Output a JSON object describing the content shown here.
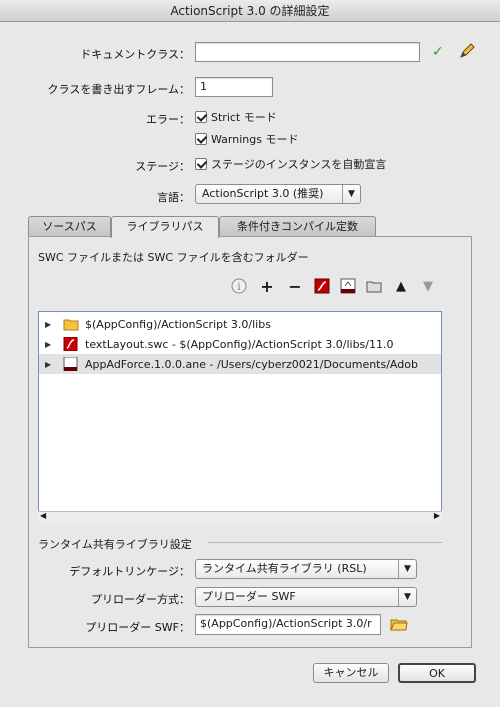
{
  "window": {
    "title": "ActionScript 3.0 の詳細設定"
  },
  "document_class": {
    "label": "ドキュメントクラス：",
    "value": ""
  },
  "export_frame": {
    "label": "クラスを書き出すフレーム：",
    "value": "1"
  },
  "errors": {
    "label": "エラー：",
    "strict_label": "Strict モード",
    "warnings_label": "Warnings モード"
  },
  "stage": {
    "label": "ステージ：",
    "checkbox_label": "ステージのインスタンスを自動宣言"
  },
  "dialect": {
    "label": "言語：",
    "selected": "ActionScript 3.0 (推奨)"
  },
  "tabs": [
    {
      "label": "ソースパス"
    },
    {
      "label": "ライブラリパス"
    },
    {
      "label": "条件付きコンパイル定数"
    }
  ],
  "library": {
    "heading": "SWC ファイルまたは SWC ファイルを含むフォルダー",
    "items": [
      {
        "text": "$(AppConfig)/ActionScript 3.0/libs"
      },
      {
        "text": "textLayout.swc - $(AppConfig)/ActionScript 3.0/libs/11.0"
      },
      {
        "text": "AppAdForce.1.0.0.ane - /Users/cyberz0021/Documents/Adob"
      }
    ]
  },
  "rsl": {
    "heading": "ランタイム共有ライブラリ設定",
    "default_linkage_label": "デフォルトリンケージ：",
    "default_linkage_value": "ランタイム共有ライブラリ (RSL)",
    "preloader_method_label": "プリローダー方式：",
    "preloader_method_value": "プリローダー SWF",
    "preloader_swf_label": "プリローダー SWF：",
    "preloader_swf_value": "$(AppConfig)/ActionScript 3.0/r"
  },
  "buttons": {
    "cancel": "キャンセル",
    "ok": "OK"
  }
}
